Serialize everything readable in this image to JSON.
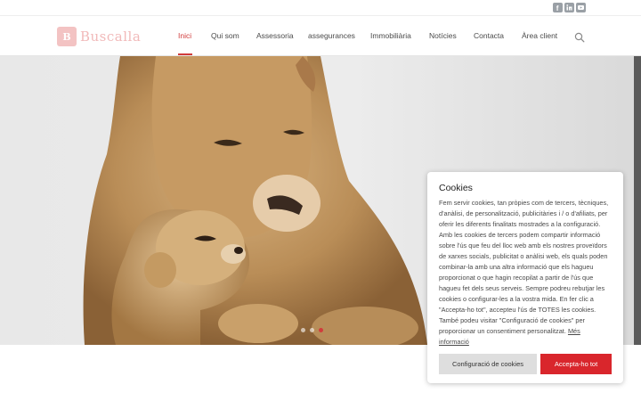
{
  "brand": {
    "logo_mark": "B",
    "name": "Buscalla"
  },
  "colors": {
    "accent": "#d13c3c",
    "accept_button": "#d9262c",
    "logo_tint": "#f1b9b9"
  },
  "social": [
    "facebook-icon",
    "linkedin-icon",
    "youtube-icon"
  ],
  "nav": {
    "items": [
      {
        "label": "Inici",
        "active": true
      },
      {
        "label": "Qui som"
      },
      {
        "label": "Assessoria"
      },
      {
        "label": "assegurances"
      },
      {
        "label": "Immobiliària"
      },
      {
        "label": "Notícies"
      },
      {
        "label": "Contacta"
      },
      {
        "label": "Àrea client"
      }
    ],
    "search_icon": "search-icon"
  },
  "hero": {
    "image": "lioness-and-cub",
    "slides": 3,
    "active_slide": 2
  },
  "cookie": {
    "title": "Cookies",
    "body": "Fem servir cookies, tan pròpies com de tercers, tècniques, d'anàlisi, de personalització, publicitàries i / o d'afiliats, per oferir les diferents finalitats mostrades a la configuració. Amb les cookies de tercers podem compartir informació sobre l'ús que feu del lloc web amb els nostres proveïdors de xarxes socials, publicitat o anàlisi web, els quals poden combinar-la amb una altra informació que els hagueu proporcionat o que hagin recopilat a partir de l'ús que hagueu fet dels seus serveis. Sempre podreu rebutjar les cookies o configurar-les a la vostra mida. En fer clic a \"Accepta-ho tot\", accepteu l'ús de TOTES les cookies. També podeu visitar \"Configuració de cookies\" per proporcionar un consentiment personalitzat.",
    "more_link": "Més informació",
    "config_button": "Configuració de cookies",
    "accept_button": "Accepta-ho tot"
  }
}
